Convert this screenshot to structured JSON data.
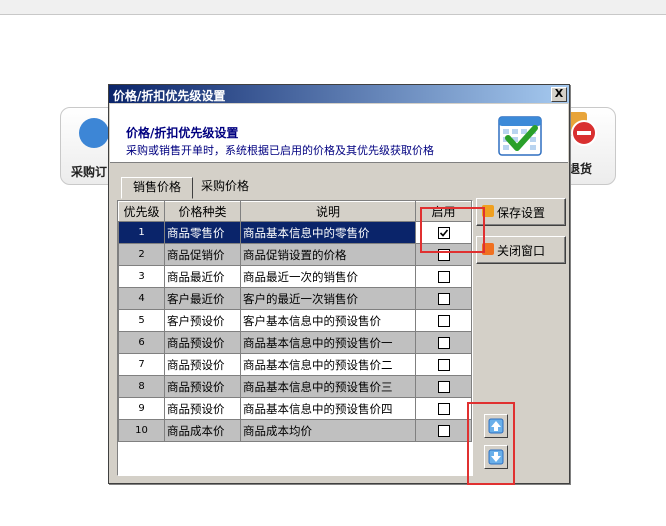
{
  "background": {
    "left_tile_label": "采购订",
    "right_tile_label": "退货"
  },
  "dialog": {
    "title": "价格/折扣优先级设置",
    "close_label": "X",
    "header_title": "价格/折扣优先级设置",
    "header_desc": "采购或销售开单时，系统根据已启用的价格及其优先级获取价格",
    "tabs": [
      {
        "label": "销售价格",
        "active": true
      },
      {
        "label": "采购价格",
        "active": false
      }
    ],
    "columns": [
      "优先级",
      "价格种类",
      "说明",
      "启用"
    ],
    "rows": [
      {
        "priority": "1",
        "type": "商品零售价",
        "desc": "商品基本信息中的零售价",
        "enabled": true
      },
      {
        "priority": "2",
        "type": "商品促销价",
        "desc": "商品促销设置的价格",
        "enabled": false
      },
      {
        "priority": "3",
        "type": "商品最近价",
        "desc": "商品最近一次的销售价",
        "enabled": false
      },
      {
        "priority": "4",
        "type": "客户最近价",
        "desc": "客户的最近一次销售价",
        "enabled": false
      },
      {
        "priority": "5",
        "type": "客户预设价",
        "desc": "客户基本信息中的预设售价",
        "enabled": false
      },
      {
        "priority": "6",
        "type": "商品预设价",
        "desc": "商品基本信息中的预设售价一",
        "enabled": false
      },
      {
        "priority": "7",
        "type": "商品预设价",
        "desc": "商品基本信息中的预设售价二",
        "enabled": false
      },
      {
        "priority": "8",
        "type": "商品预设价",
        "desc": "商品基本信息中的预设售价三",
        "enabled": false
      },
      {
        "priority": "9",
        "type": "商品预设价",
        "desc": "商品基本信息中的预设售价四",
        "enabled": false
      },
      {
        "priority": "10",
        "type": "商品成本价",
        "desc": "商品成本均价",
        "enabled": false
      }
    ],
    "selected_row": 1,
    "buttons": {
      "save": "保存设置",
      "close": "关闭窗口"
    },
    "icons": {
      "header": "calendar-check-icon",
      "move_up": "arrow-up-icon",
      "move_down": "arrow-down-icon"
    },
    "colors": {
      "titlebar": "#0a246a",
      "selection": "#0a246a",
      "highlight_box": "#e03030"
    }
  }
}
